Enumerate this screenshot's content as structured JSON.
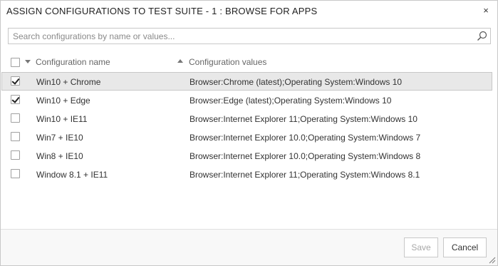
{
  "dialog": {
    "title": "ASSIGN CONFIGURATIONS TO TEST SUITE - 1 : BROWSE FOR APPS",
    "close_glyph": "×"
  },
  "search": {
    "value": "",
    "placeholder": "Search configurations by name or values..."
  },
  "table": {
    "columns": {
      "name": "Configuration name",
      "values": "Configuration values"
    },
    "rows": [
      {
        "name": "Win10 + Chrome",
        "values": "Browser:Chrome (latest);Operating System:Windows 10",
        "checked": true,
        "selected": true
      },
      {
        "name": "Win10 + Edge",
        "values": "Browser:Edge (latest);Operating System:Windows 10",
        "checked": true,
        "selected": false
      },
      {
        "name": "Win10 + IE11",
        "values": "Browser:Internet Explorer 11;Operating System:Windows 10",
        "checked": false,
        "selected": false
      },
      {
        "name": "Win7 + IE10",
        "values": "Browser:Internet Explorer 10.0;Operating System:Windows 7",
        "checked": false,
        "selected": false
      },
      {
        "name": "Win8 + IE10",
        "values": "Browser:Internet Explorer 10.0;Operating System:Windows 8",
        "checked": false,
        "selected": false
      },
      {
        "name": "Window 8.1 + IE11",
        "values": "Browser:Internet Explorer 11;Operating System:Windows 8.1",
        "checked": false,
        "selected": false
      }
    ]
  },
  "footer": {
    "save_label": "Save",
    "cancel_label": "Cancel",
    "save_disabled": true
  },
  "icons": {
    "search": "search-icon",
    "close": "close-icon",
    "sort_desc": "sort-descending-icon",
    "sort_asc": "sort-ascending-icon",
    "resize": "resize-grip-icon"
  }
}
